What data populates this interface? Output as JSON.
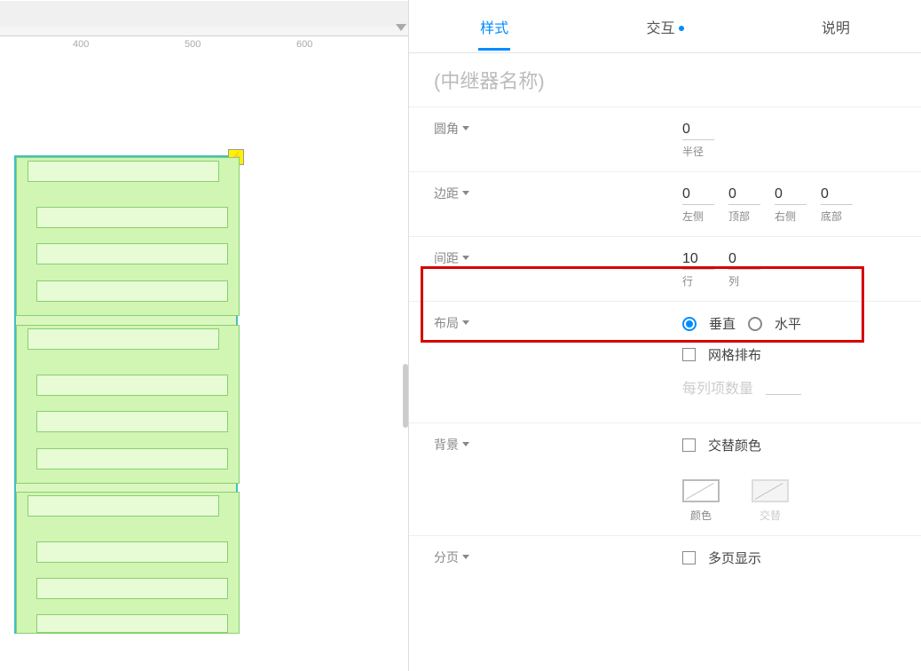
{
  "ruler": {
    "ticks": [
      "400",
      "500",
      "600"
    ]
  },
  "tabs": {
    "style": "样式",
    "interaction": "交互",
    "notes": "说明"
  },
  "name_placeholder": "(中继器名称)",
  "radius": {
    "label": "圆角",
    "value": "0",
    "sub": "半径"
  },
  "padding": {
    "label": "边距",
    "left": {
      "v": "0",
      "sub": "左侧"
    },
    "top": {
      "v": "0",
      "sub": "顶部"
    },
    "right": {
      "v": "0",
      "sub": "右侧"
    },
    "bottom": {
      "v": "0",
      "sub": "底部"
    }
  },
  "spacing": {
    "label": "间距",
    "row": {
      "v": "10",
      "sub": "行"
    },
    "col": {
      "v": "0",
      "sub": "列"
    }
  },
  "layout": {
    "label": "布局",
    "vertical": "垂直",
    "horizontal": "水平",
    "grid": "网格排布",
    "perCol": "每列项数量"
  },
  "bg": {
    "label": "背景",
    "alt": "交替颜色",
    "color": "颜色",
    "altSw": "交替"
  },
  "paging": {
    "label": "分页",
    "multi": "多页显示"
  }
}
